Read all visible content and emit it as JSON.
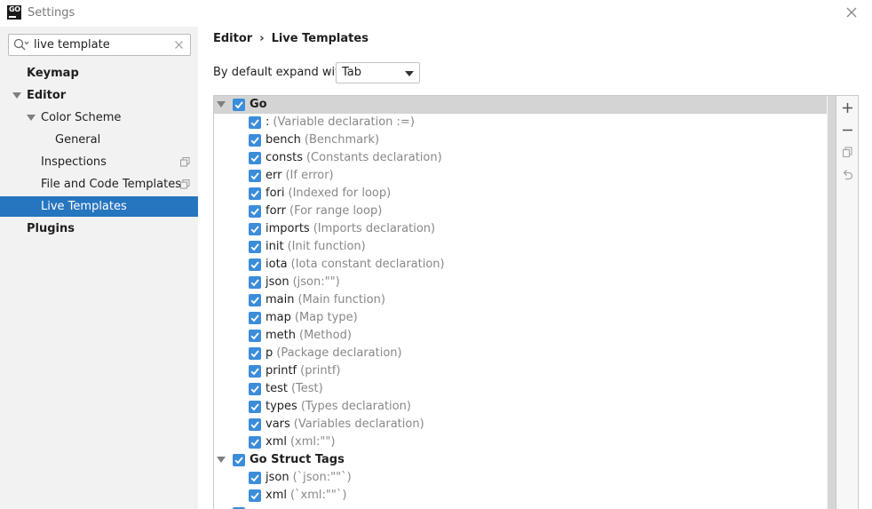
{
  "window": {
    "title": "Settings",
    "logo_text": "GO"
  },
  "sidebar": {
    "search": {
      "value": "live template",
      "placeholder": ""
    },
    "items": [
      {
        "label": "Keymap"
      },
      {
        "label": "Editor"
      },
      {
        "label": "Color Scheme"
      },
      {
        "label": "General"
      },
      {
        "label": "Inspections"
      },
      {
        "label": "File and Code Templates"
      },
      {
        "label": "Live Templates"
      },
      {
        "label": "Plugins"
      }
    ]
  },
  "breadcrumb": {
    "parent": "Editor",
    "separator": "›",
    "current": "Live Templates"
  },
  "expand": {
    "label": "By default expand with",
    "selected": "Tab"
  },
  "groups": [
    {
      "name": "Go",
      "items": [
        {
          "abbr": ":",
          "desc": "(Variable declaration :=)"
        },
        {
          "abbr": "bench",
          "desc": "(Benchmark)"
        },
        {
          "abbr": "consts",
          "desc": "(Constants declaration)"
        },
        {
          "abbr": "err",
          "desc": "(If error)"
        },
        {
          "abbr": "fori",
          "desc": "(Indexed for loop)"
        },
        {
          "abbr": "forr",
          "desc": "(For range loop)"
        },
        {
          "abbr": "imports",
          "desc": "(Imports declaration)"
        },
        {
          "abbr": "init",
          "desc": "(Init function)"
        },
        {
          "abbr": "iota",
          "desc": "(Iota constant declaration)"
        },
        {
          "abbr": "json",
          "desc": "(json:\"\")"
        },
        {
          "abbr": "main",
          "desc": "(Main function)"
        },
        {
          "abbr": "map",
          "desc": "(Map type)"
        },
        {
          "abbr": "meth",
          "desc": "(Method)"
        },
        {
          "abbr": "p",
          "desc": "(Package declaration)"
        },
        {
          "abbr": "printf",
          "desc": "(printf)"
        },
        {
          "abbr": "test",
          "desc": "(Test)"
        },
        {
          "abbr": "types",
          "desc": "(Types declaration)"
        },
        {
          "abbr": "vars",
          "desc": "(Variables declaration)"
        },
        {
          "abbr": "xml",
          "desc": "(xml:\"\")"
        }
      ]
    },
    {
      "name": "Go Struct Tags",
      "items": [
        {
          "abbr": "json",
          "desc": "(`json:\"\"`)"
        },
        {
          "abbr": "xml",
          "desc": "(`xml:\"\"`)"
        }
      ]
    }
  ],
  "colors": {
    "selection": "#2675bf",
    "checkbox": "#3b8dd9",
    "description_text": "#888888",
    "sidebar_bg": "#f2f2f2"
  },
  "icons": {
    "search": "search-icon",
    "clear": "clear-icon",
    "close": "close-icon",
    "add": "plus-icon",
    "remove": "minus-icon",
    "copy": "copy-icon",
    "revert": "undo-icon"
  }
}
